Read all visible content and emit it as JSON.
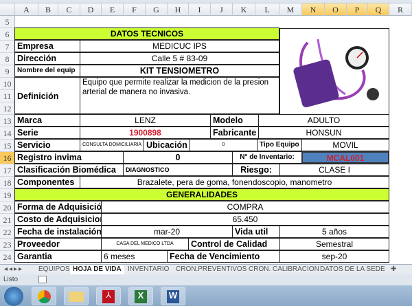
{
  "columns": [
    "A",
    "B",
    "C",
    "D",
    "E",
    "F",
    "G",
    "H",
    "I",
    "J",
    "K",
    "L",
    "M",
    "N",
    "O",
    "P",
    "Q",
    "R"
  ],
  "rows": [
    "5",
    "6",
    "7",
    "8",
    "9",
    "10",
    "11",
    "12",
    "13",
    "14",
    "15",
    "16",
    "17",
    "18",
    "19",
    "20",
    "21",
    "22",
    "23",
    "24"
  ],
  "datos": {
    "title": "DATOS TECNICOS",
    "empresa_l": "Empresa",
    "empresa": "MEDICUC IPS",
    "direccion_l": "Dirección",
    "direccion": "Calle 5 # 83-09",
    "nombre_l": "Nombre del equip",
    "nombre": "KIT TENSIOMETRO",
    "definicion_l": "Definición",
    "definicion": "Equipo que permite realizar la medicion de la presion arterial de manera no invasiva.",
    "marca_l": "Marca",
    "marca": "LENZ",
    "modelo_l": "Modelo",
    "modelo": "ADULTO",
    "serie_l": "Serie",
    "serie": "1900898",
    "fabricante_l": "Fabricante",
    "fabricante": "HONSUN",
    "servicio_l": "Servicio",
    "servicio": "CONSULTA DOMICILIARIA",
    "ubicacion_l": "Ubicación",
    "ubicacion": "0",
    "tipo_l": "Tipo Equipo",
    "tipo": "MOVIL",
    "invima_l": "Registro invima",
    "invima": "0",
    "inventario_l": "N° de Inventario:",
    "inventario": "MCAL001",
    "clasif_l": "Clasificación Biomédica",
    "clasif": "DIAGNOSTICO",
    "riesgo_l": "Riesgo:",
    "riesgo": "CLASE I",
    "componentes_l": "Componentes",
    "componentes": "Brazalete, pera de goma, fonendoscopio, manometro"
  },
  "generalidades": {
    "title": "GENERALIDADES",
    "forma_l": "Forma de Adquisición",
    "forma": "COMPRA",
    "costo_l": "Costo de Adquisicion",
    "costo": "65.450",
    "fecha_l": "Fecha de instalación",
    "fecha": "mar-20",
    "vida_l": "Vida util",
    "vida": "5 años",
    "proveedor_l": "Proveedor",
    "proveedor": "CASA DEL MEDICO LTDA",
    "control_l": "Control de Calidad",
    "control": "Semestral",
    "garantia_l": "Garantia",
    "garantia": "6 meses",
    "venc_l": "Fecha de Vencimiento",
    "venc": "sep-20"
  },
  "sheets": [
    "EQUIPOS",
    "HOJA DE VIDA",
    "INVENTARIO",
    "CRON.PREVENTIVOS",
    "CRON. CALIBRACION",
    "DATOS DE LA SEDE"
  ],
  "status": "Listo",
  "colors": {
    "green": "#ccff33",
    "selected": "#4f81bd",
    "serial": "#d0202f"
  }
}
